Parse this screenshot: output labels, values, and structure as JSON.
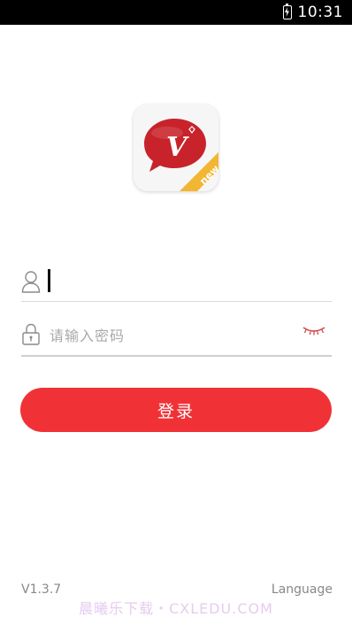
{
  "status_bar": {
    "time": "10:31",
    "battery_icon": "battery-charging-icon"
  },
  "app_icon": {
    "letter": "V",
    "badge": "new",
    "colors": {
      "brand_red": "#c8232b",
      "badge_yellow": "#f2b632"
    }
  },
  "login_form": {
    "username": {
      "icon": "user-icon",
      "value": "",
      "placeholder": ""
    },
    "password": {
      "icon": "lock-icon",
      "placeholder": "请输入密码",
      "visibility_icon": "eye-closed-icon"
    },
    "login_button_label": "登录",
    "accent_color": "#f03237"
  },
  "footer": {
    "version": "V1.3.7",
    "language_label": "Language",
    "watermark": "晨曦乐下载・CXLEDU.COM"
  }
}
